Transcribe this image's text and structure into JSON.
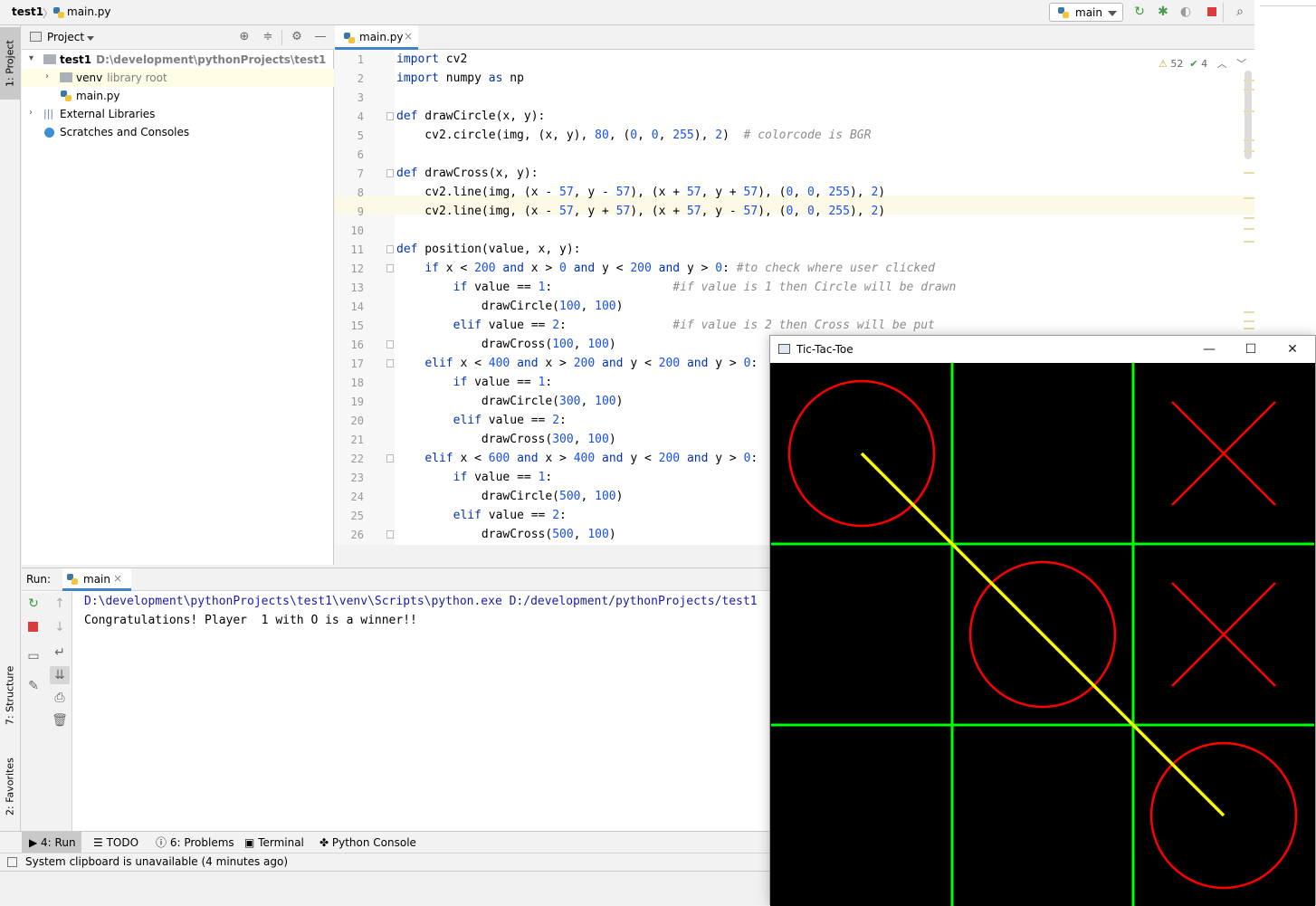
{
  "navbar": {
    "project": "test1",
    "separator": "〉",
    "file": "main.py",
    "run_config": "main"
  },
  "left_stripe": {
    "project": "1: Project",
    "structure": "7: Structure",
    "favorites": "2: Favorites"
  },
  "project_panel": {
    "title": "Project",
    "tree": [
      {
        "label": "test1",
        "sub": "D:\\development\\pythonProjects\\test1"
      },
      {
        "label": "venv",
        "sub": "library root"
      },
      {
        "label": "main.py",
        "sub": ""
      },
      {
        "label": "External Libraries",
        "sub": ""
      },
      {
        "label": "Scratches and Consoles",
        "sub": ""
      }
    ]
  },
  "editor": {
    "tab": "main.py",
    "warnings": "52",
    "weak_warnings": "4",
    "line_numbers": [
      "1",
      "2",
      "3",
      "4",
      "5",
      "6",
      "7",
      "8",
      "9",
      "10",
      "11",
      "12",
      "13",
      "14",
      "15",
      "16",
      "17",
      "18",
      "19",
      "20",
      "21",
      "22",
      "23",
      "24",
      "25",
      "26"
    ]
  },
  "run": {
    "title": "Run:",
    "tab": "main",
    "command": "D:\\development\\pythonProjects\\test1\\venv\\Scripts\\python.exe D:/development/pythonProjects/test1",
    "output": "Congratulations! Player  1 with O is a winner!!"
  },
  "tool_windows": {
    "run": "4: Run",
    "todo": "TODO",
    "problems": "6: Problems",
    "terminal": "Terminal",
    "console": "Python Console"
  },
  "status": "System clipboard is unavailable (4 minutes ago)",
  "cv_window": {
    "title": "Tic-Tac-Toe",
    "grid_color": "#00ff00",
    "mark_color": "#ff0000",
    "win_line_color": "#ffff00",
    "board": [
      [
        "O",
        "",
        "X"
      ],
      [
        "",
        "O",
        "X"
      ],
      [
        "",
        "",
        "O"
      ]
    ]
  }
}
